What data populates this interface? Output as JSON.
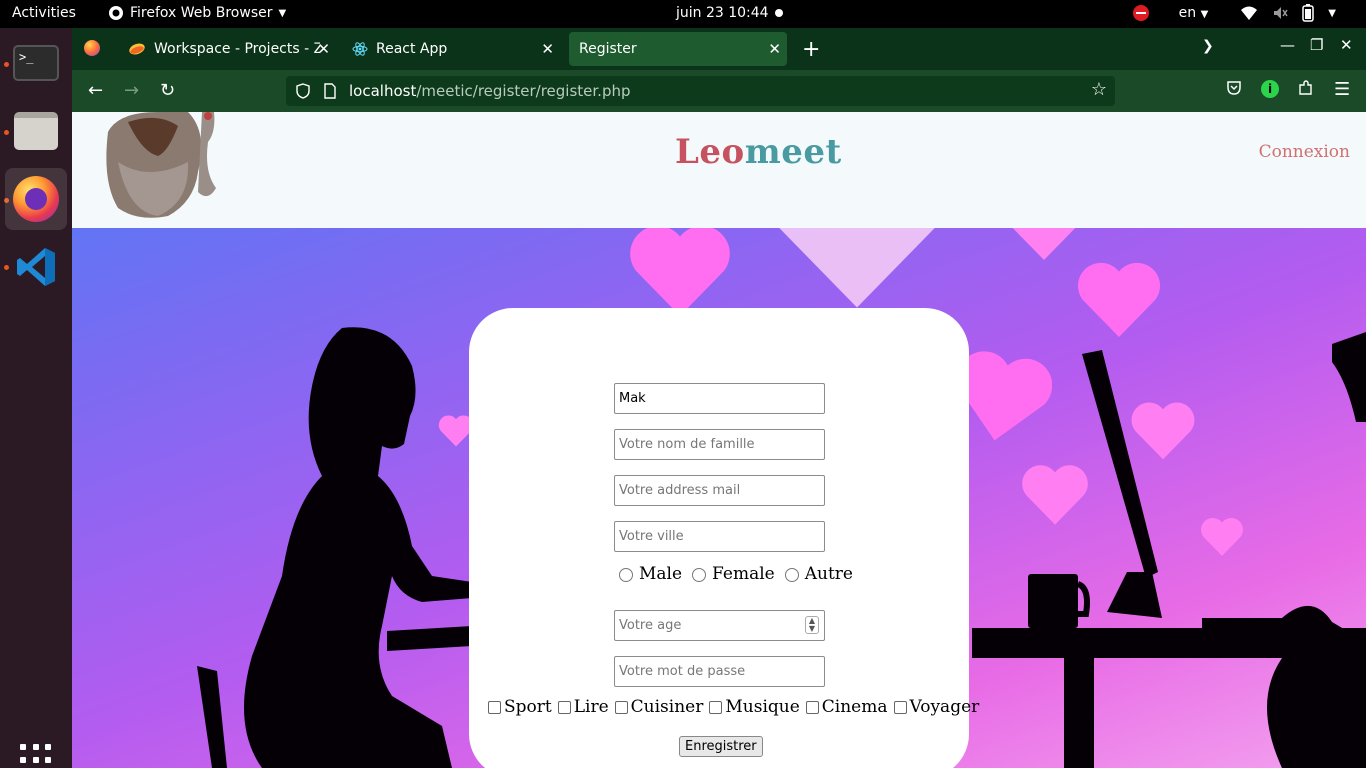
{
  "topbar": {
    "activities": "Activities",
    "app_name": "Firefox Web Browser",
    "clock": "juin 23  10:44",
    "language": "en"
  },
  "dock": {
    "items": [
      "terminal",
      "files",
      "firefox",
      "vscode"
    ],
    "run_dot_color": "#e95420"
  },
  "browser": {
    "tabs": [
      {
        "label": "Workspace - Projects - Ze",
        "icon": "zeplin-icon"
      },
      {
        "label": "React App",
        "icon": "react-icon"
      },
      {
        "label": "Register",
        "icon": "none",
        "active": true
      }
    ],
    "url_host": "localhost",
    "url_path": "/meetic/register/register.php",
    "theme_colors": {
      "tabbar": "#0a3319",
      "navbar": "#1a4a28"
    }
  },
  "site": {
    "brand_part1": "Leo",
    "brand_part2": "meet",
    "connexion": "Connexion",
    "colors": {
      "brand_red": "#c5525e",
      "brand_teal": "#4a9aa2",
      "connexion": "#d0706f"
    }
  },
  "form": {
    "first_name_value": "Mak",
    "last_name_placeholder": "Votre nom de famille",
    "email_placeholder": "Votre address mail",
    "city_placeholder": "Votre ville",
    "gender_options": [
      "Male",
      "Female",
      "Autre"
    ],
    "age_placeholder": "Votre age",
    "password_placeholder": "Votre mot de passe",
    "hobbies": [
      "Sport",
      "Lire",
      "Cuisiner",
      "Musique",
      "Cinema",
      "Voyager"
    ],
    "submit_label": "Enregistrer"
  }
}
